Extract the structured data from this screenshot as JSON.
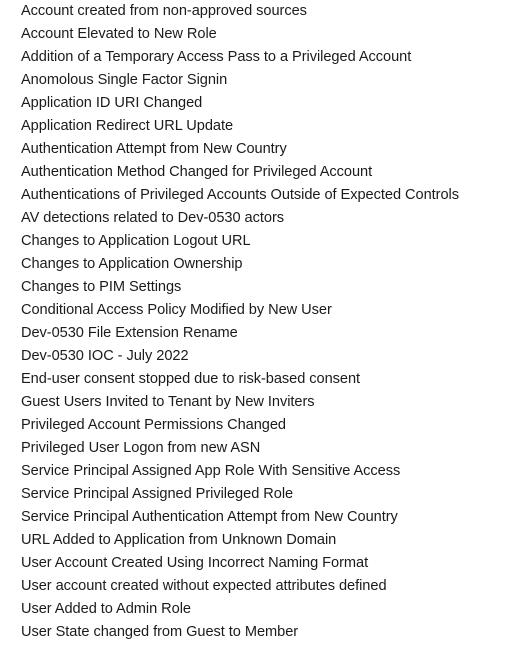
{
  "document": {
    "kind": "plain-text-list",
    "background_color": "#ffffff",
    "text_color": "#1b1b1b",
    "line_count": 27
  },
  "rule_list": {
    "items": [
      {
        "label": "Account created from non-approved sources"
      },
      {
        "label": "Account Elevated to New Role"
      },
      {
        "label": "Addition of a Temporary Access Pass to a Privileged Account"
      },
      {
        "label": "Anomolous Single Factor Signin"
      },
      {
        "label": "Application ID URI Changed"
      },
      {
        "label": "Application Redirect URL Update"
      },
      {
        "label": "Authentication Attempt from New Country"
      },
      {
        "label": "Authentication Method Changed for Privileged Account"
      },
      {
        "label": "Authentications of Privileged Accounts Outside of Expected Controls"
      },
      {
        "label": "AV detections related to Dev-0530 actors"
      },
      {
        "label": "Changes to Application Logout URL"
      },
      {
        "label": "Changes to Application Ownership"
      },
      {
        "label": "Changes to PIM Settings"
      },
      {
        "label": "Conditional Access Policy Modified by New User"
      },
      {
        "label": "Dev-0530 File Extension Rename"
      },
      {
        "label": "Dev-0530 IOC - July 2022"
      },
      {
        "label": "End-user consent stopped due to risk-based consent"
      },
      {
        "label": "Guest Users Invited to Tenant by New Inviters"
      },
      {
        "label": "Privileged Account Permissions Changed"
      },
      {
        "label": "Privileged User Logon from new ASN"
      },
      {
        "label": "Service Principal Assigned App Role With Sensitive Access"
      },
      {
        "label": "Service Principal Assigned Privileged Role"
      },
      {
        "label": "Service Principal Authentication Attempt from New Country"
      },
      {
        "label": "URL Added to Application from Unknown Domain"
      },
      {
        "label": "User Account Created Using Incorrect Naming Format"
      },
      {
        "label": "User account created without expected attributes defined"
      },
      {
        "label": "User Added to Admin Role"
      },
      {
        "label": "User State changed from Guest to Member"
      }
    ]
  }
}
